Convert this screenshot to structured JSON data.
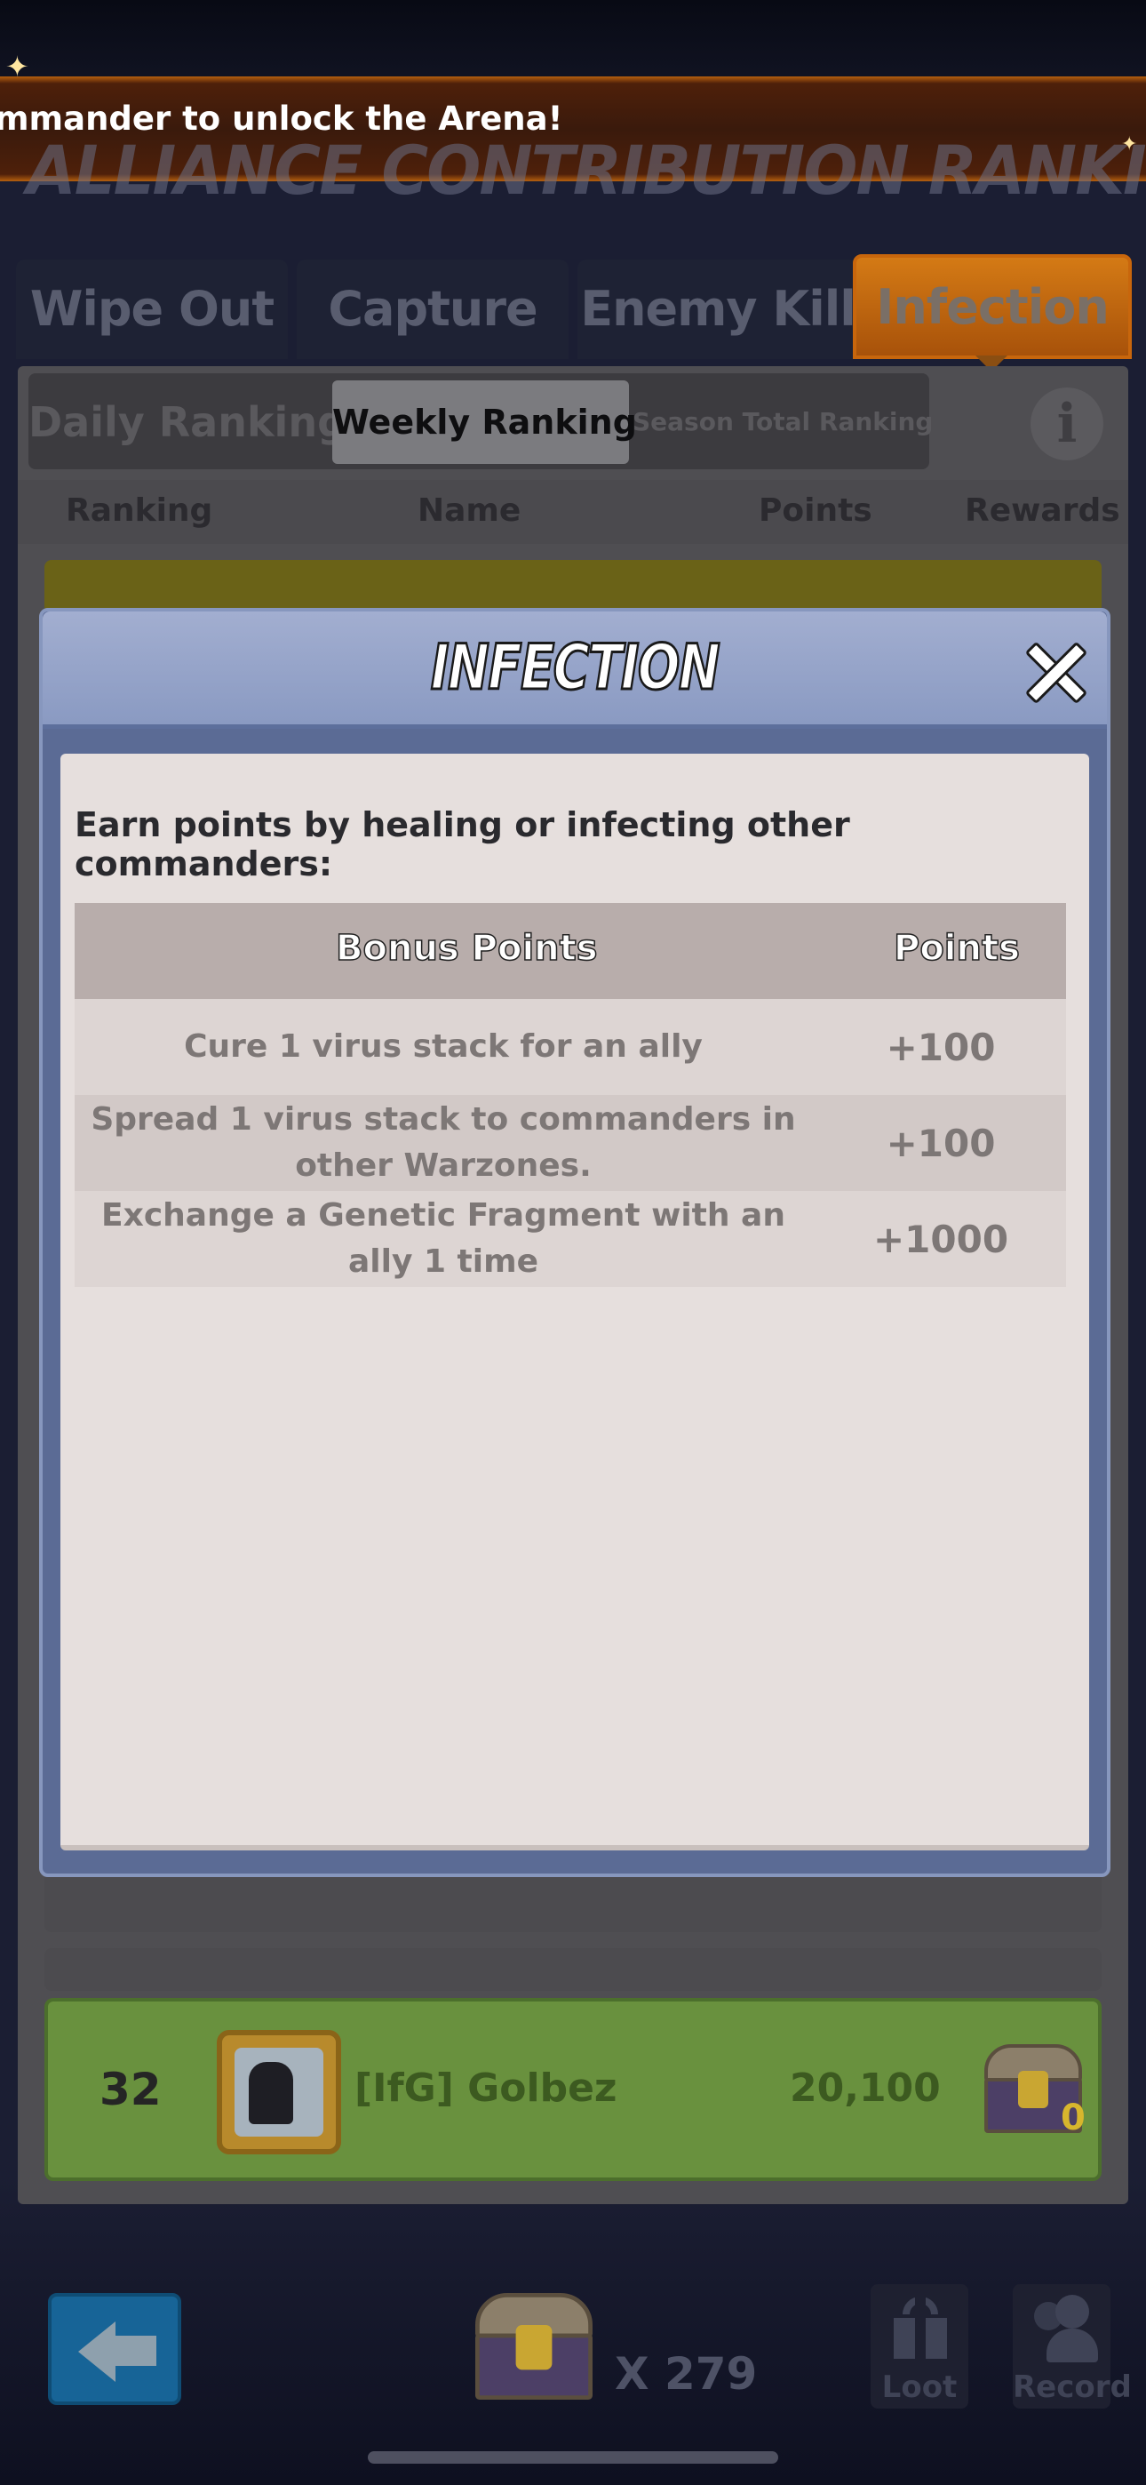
{
  "banner": {
    "text": "mmander to unlock the Arena!",
    "title": "ALLIANCE CONTRIBUTION RANKING"
  },
  "main_tabs": [
    {
      "label": "Wipe Out",
      "active": false
    },
    {
      "label": "Capture",
      "active": false
    },
    {
      "label": "Enemy Kill",
      "active": false
    },
    {
      "label": "Infection",
      "active": true
    }
  ],
  "sub_tabs": [
    {
      "label": "Daily Ranking",
      "active": false
    },
    {
      "label": "Weekly Ranking",
      "active": true
    },
    {
      "label": "Season Total Ranking",
      "active": false
    }
  ],
  "columns": {
    "ranking": "Ranking",
    "name": "Name",
    "points": "Points",
    "rewards": "Rewards"
  },
  "my_entry": {
    "rank": "32",
    "name": "[IfG] Golbez",
    "points": "20,100",
    "reward_count": "0"
  },
  "bottom_bar": {
    "chest_count": "X 279",
    "loot_label": "Loot",
    "record_label": "Record"
  },
  "modal": {
    "title": "INFECTION",
    "intro": "Earn points by healing or infecting other commanders:",
    "table": {
      "headers": [
        "Bonus Points",
        "Points"
      ],
      "rows": [
        {
          "action": "Cure 1 virus stack for an ally",
          "points": "+100"
        },
        {
          "action": "Spread 1 virus stack to commanders in other Warzones.",
          "points": "+100"
        },
        {
          "action": "Exchange a Genetic Fragment with an ally 1 time",
          "points": "+1000"
        }
      ]
    }
  },
  "colors": {
    "active_tab": "#c8660c",
    "modal_header": "#8a9ac2",
    "my_row": "#69913e",
    "back_button": "#176497"
  }
}
